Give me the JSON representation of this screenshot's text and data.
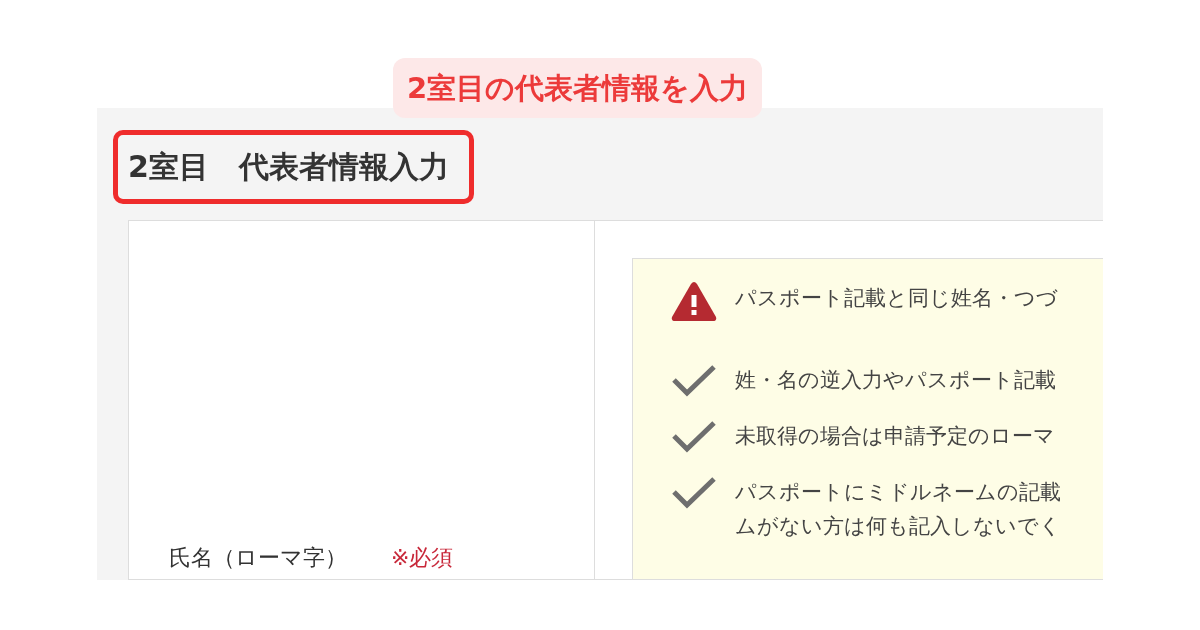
{
  "annotation": {
    "text": "2室目の代表者情報を入力"
  },
  "section": {
    "title": "2室目　代表者情報入力",
    "highlighted": true
  },
  "form": {
    "label": "氏名（ローマ字）",
    "required": "※必須"
  },
  "notice": {
    "items": [
      {
        "kind": "warning",
        "lines": [
          "パスポート記載と同じ姓名・つづ"
        ]
      },
      {
        "kind": "check",
        "lines": [
          "姓・名の逆入力やパスポート記載"
        ]
      },
      {
        "kind": "check",
        "lines": [
          "未取得の場合は申請予定のローマ"
        ]
      },
      {
        "kind": "check",
        "lines": [
          "パスポートにミドルネームの記載",
          "ムがない方は何も記入しないでく"
        ]
      }
    ]
  }
}
